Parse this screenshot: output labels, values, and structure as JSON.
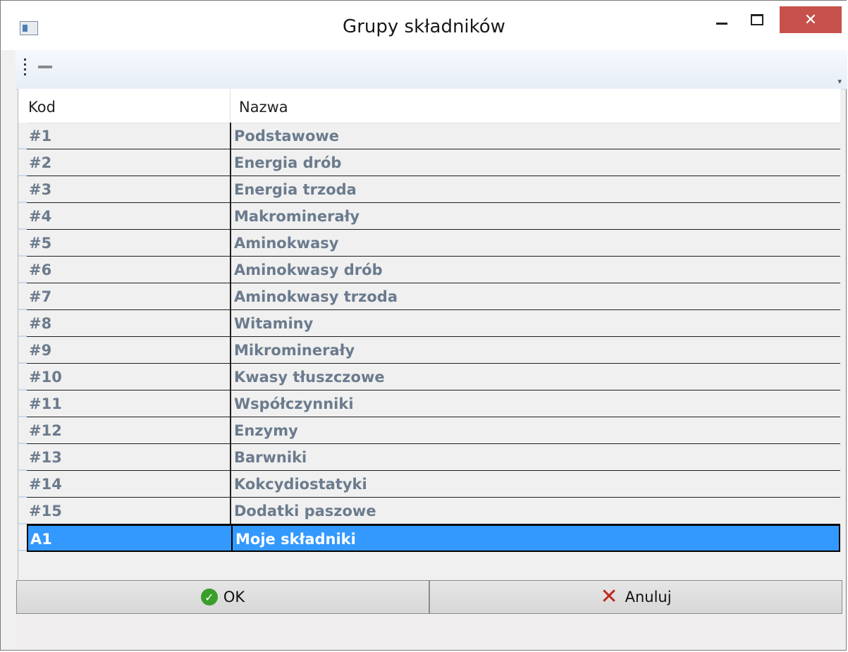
{
  "window": {
    "title": "Grupy składników",
    "close_label": "✕"
  },
  "grid": {
    "columns": [
      "Kod",
      "Nazwa"
    ],
    "rows": [
      {
        "kod": "#1",
        "nazwa": "Podstawowe"
      },
      {
        "kod": "#2",
        "nazwa": "Energia drób"
      },
      {
        "kod": "#3",
        "nazwa": "Energia trzoda"
      },
      {
        "kod": "#4",
        "nazwa": "Makrominerały"
      },
      {
        "kod": "#5",
        "nazwa": "Aminokwasy"
      },
      {
        "kod": "#6",
        "nazwa": "Aminokwasy drób"
      },
      {
        "kod": "#7",
        "nazwa": "Aminokwasy trzoda"
      },
      {
        "kod": "#8",
        "nazwa": "Witaminy"
      },
      {
        "kod": "#9",
        "nazwa": "Mikrominerały"
      },
      {
        "kod": "#10",
        "nazwa": "Kwasy tłuszczowe"
      },
      {
        "kod": "#11",
        "nazwa": "Współczynniki"
      },
      {
        "kod": "#12",
        "nazwa": "Enzymy"
      },
      {
        "kod": "#13",
        "nazwa": "Barwniki"
      },
      {
        "kod": "#14",
        "nazwa": "Kokcydiostatyki"
      },
      {
        "kod": "#15",
        "nazwa": "Dodatki paszowe"
      },
      {
        "kod": "A1",
        "nazwa": "Moje składniki",
        "selected": true
      }
    ]
  },
  "buttons": {
    "ok_label": "OK",
    "cancel_label": "Anuluj"
  },
  "colors": {
    "selection": "#3399ff",
    "row_text": "#6b7b8d",
    "close_button": "#c7504b",
    "ok_icon": "#3a9e2a",
    "cancel_icon": "#c0271e"
  }
}
